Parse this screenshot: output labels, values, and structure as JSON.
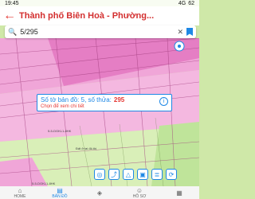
{
  "status": {
    "time": "19:45",
    "signal": "4G",
    "battery": "62"
  },
  "header": {
    "title": "Thành phố Biên Hoà - Phường..."
  },
  "search": {
    "query": "5/295"
  },
  "parcel": {
    "title_prefix": "Số tờ bản đồ: 5, số thửa:",
    "number": "295",
    "hint": "Chọn để xem chi tiết"
  },
  "map_labels": {
    "road1": "5-5-DGKL1-8HK",
    "road2": "Đất ở tai đô thị",
    "road3": "5-5-DGKL1-8HK"
  },
  "bottom_nav": [
    {
      "label": "HOME",
      "icon": "home-icon"
    },
    {
      "label": "BẢN ĐỒ",
      "icon": "map-icon"
    },
    {
      "label": "",
      "icon": "layers-icon"
    },
    {
      "label": "HỒ SƠ",
      "icon": "user-icon"
    },
    {
      "label": "",
      "icon": "grid-icon"
    }
  ],
  "colors": {
    "accent": "#1e88e5",
    "title": "#d32f2f",
    "land_pink": "#f0a6d8",
    "land_green": "#cfe8a8"
  }
}
